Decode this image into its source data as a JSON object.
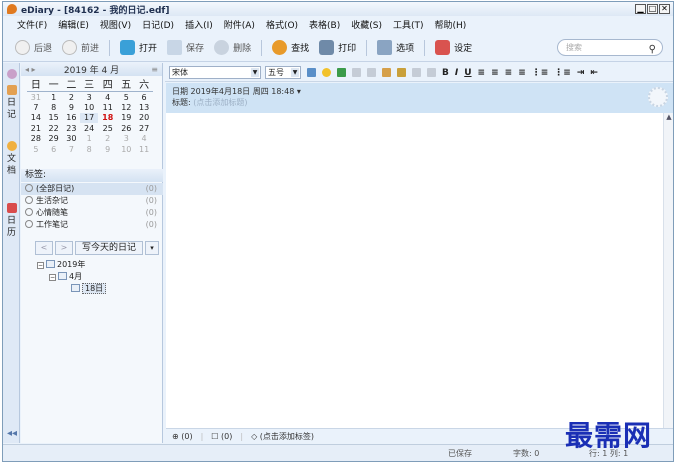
{
  "window": {
    "title": "eDiary - [84162 - 我的日记.edf]",
    "controls": [
      "▁",
      "□",
      "✕"
    ]
  },
  "menu": [
    "文件(F)",
    "编辑(E)",
    "视图(V)",
    "日记(D)",
    "插入(I)",
    "附件(A)",
    "格式(O)",
    "表格(B)",
    "收藏(S)",
    "工具(T)",
    "帮助(H)"
  ],
  "toolbar": {
    "back": "后退",
    "forward": "前进",
    "open": "打开",
    "save": "保存",
    "delete": "删除",
    "find": "查找",
    "print": "打印",
    "options": "选项",
    "settings": "设定",
    "search_placeholder": "搜索"
  },
  "vtabs": {
    "diary": "日记",
    "docs": "文档",
    "calendar": "日历"
  },
  "calendar": {
    "month_label": "2019 年 4 月",
    "weekdays": [
      "日",
      "一",
      "二",
      "三",
      "四",
      "五",
      "六"
    ],
    "weeks": [
      [
        "31",
        "1",
        "2",
        "3",
        "4",
        "5",
        "6"
      ],
      [
        "7",
        "8",
        "9",
        "10",
        "11",
        "12",
        "13"
      ],
      [
        "14",
        "15",
        "16",
        "17",
        "18",
        "19",
        "20"
      ],
      [
        "21",
        "22",
        "23",
        "24",
        "25",
        "26",
        "27"
      ],
      [
        "28",
        "29",
        "30",
        "1",
        "2",
        "3",
        "4"
      ],
      [
        "5",
        "6",
        "7",
        "8",
        "9",
        "10",
        "11"
      ]
    ],
    "today": "18"
  },
  "tags": {
    "header": "标签:",
    "items": [
      {
        "label": "(全部日记)",
        "count": "(0)"
      },
      {
        "label": "生活杂记",
        "count": "(0)"
      },
      {
        "label": "心情随笔",
        "count": "(0)"
      },
      {
        "label": "工作笔记",
        "count": "(0)"
      }
    ]
  },
  "write_today": "写今天的日记",
  "tree": {
    "year": "2019年",
    "month": "4月",
    "day": "18日"
  },
  "format": {
    "font": "宋体",
    "size": "五号"
  },
  "entry": {
    "date": "日期  2019年4月18日 周四 18:48",
    "title_label": "标题:",
    "title_hint": "(点击添加标题)"
  },
  "editor_bottom": {
    "attach": "(0)",
    "comments": "(0)",
    "tag_hint": "(点击添加标签)"
  },
  "status": {
    "saved": "已保存",
    "words": "字数: 0",
    "position": "行: 1  列: 1"
  },
  "watermark": "最需网"
}
